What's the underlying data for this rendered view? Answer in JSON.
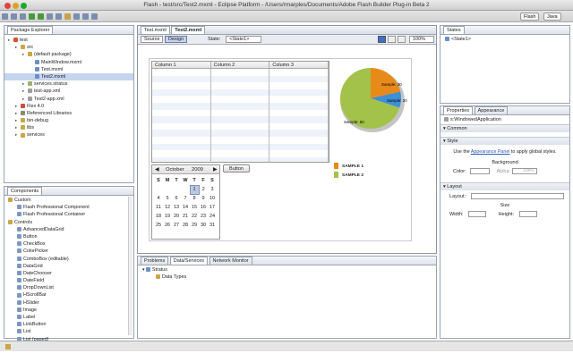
{
  "window": {
    "title": "Flash - test/src/Test2.mxml - Eclipse Platform - /Users/rmarples/Documents/Adobe Flash Builder Plug-in Beta 2"
  },
  "perspectives": [
    "Flash",
    "Java"
  ],
  "package_explorer": {
    "tab": "Package Explorer",
    "items": [
      {
        "label": "test",
        "indent": 0,
        "color": "#d9532c"
      },
      {
        "label": "src",
        "indent": 1,
        "color": "#c9a646"
      },
      {
        "label": "(default package)",
        "indent": 2,
        "color": "#c9a646"
      },
      {
        "label": "MainWindow.mxml",
        "indent": 3,
        "color": "#6b8fc7"
      },
      {
        "label": "Test.mxml",
        "indent": 3,
        "color": "#6b8fc7"
      },
      {
        "label": "Test2.mxml",
        "indent": 3,
        "color": "#6b8fc7",
        "selected": true
      },
      {
        "label": "services.stratus",
        "indent": 2,
        "color": "#9bb06a"
      },
      {
        "label": "test-app.xml",
        "indent": 2,
        "color": "#9e9e9e"
      },
      {
        "label": "Test2-app.xml",
        "indent": 2,
        "color": "#9e9e9e"
      },
      {
        "label": "Flex 4.0",
        "indent": 1,
        "color": "#c74f3e"
      },
      {
        "label": "Referenced Libraries",
        "indent": 1,
        "color": "#8a8a6a"
      },
      {
        "label": "bin-debug",
        "indent": 1,
        "color": "#c9a646"
      },
      {
        "label": "libs",
        "indent": 1,
        "color": "#c9a646"
      },
      {
        "label": "services",
        "indent": 1,
        "color": "#c9a646"
      }
    ]
  },
  "components": {
    "tab": "Components",
    "items": [
      {
        "label": "Custom",
        "folder": true
      },
      {
        "label": "Flash Professional Component"
      },
      {
        "label": "Flash Professional Container"
      },
      {
        "label": "Controls",
        "folder": true
      },
      {
        "label": "AdvancedDataGrid"
      },
      {
        "label": "Button"
      },
      {
        "label": "CheckBox"
      },
      {
        "label": "ColorPicker"
      },
      {
        "label": "ComboBox (editable)"
      },
      {
        "label": "DataGrid"
      },
      {
        "label": "DateChooser"
      },
      {
        "label": "DateField"
      },
      {
        "label": "DropDownList"
      },
      {
        "label": "HScrollBar"
      },
      {
        "label": "HSlider"
      },
      {
        "label": "Image"
      },
      {
        "label": "Label"
      },
      {
        "label": "LinkButton"
      },
      {
        "label": "List"
      },
      {
        "label": "List (paged)"
      }
    ]
  },
  "editor": {
    "tabs": [
      "Test.mxml",
      "Test2.mxml"
    ],
    "source_label": "Source",
    "design_label": "Design",
    "state_label": "State:",
    "state_value": "<State1>",
    "zoom": "100%",
    "datagrid": {
      "columns": [
        "Column 1",
        "Column 2",
        "Column 3"
      ]
    },
    "calendar": {
      "month": "October",
      "year": "2009",
      "days": [
        "S",
        "M",
        "T",
        "W",
        "T",
        "F",
        "S"
      ],
      "weeks": [
        [
          "",
          "",
          "",
          "",
          "1",
          "2",
          "3"
        ],
        [
          "4",
          "5",
          "6",
          "7",
          "8",
          "9",
          "10"
        ],
        [
          "11",
          "12",
          "13",
          "14",
          "15",
          "16",
          "17"
        ],
        [
          "18",
          "19",
          "20",
          "21",
          "22",
          "23",
          "24"
        ],
        [
          "25",
          "26",
          "27",
          "28",
          "29",
          "30",
          "31"
        ]
      ],
      "selected": "1"
    },
    "button_label": "Button",
    "pie": {
      "labels": [
        "Sample: 30",
        "Sample: 50",
        "Sample: 20"
      ]
    },
    "legend": [
      "SAMPLE 1",
      "SAMPLE 2"
    ],
    "colors": {
      "orange": "#e88a1a",
      "green": "#a3c24a",
      "blue": "#3d8fd6"
    }
  },
  "states": {
    "tab": "States",
    "item": "<State1>"
  },
  "properties": {
    "tabs": [
      "Properties",
      "Appearance"
    ],
    "app_name": "s:WindowedApplication",
    "common_label": "Common",
    "style_label": "Style",
    "style_hint_pre": "Use the ",
    "style_hint_link": "Appearance Panel",
    "style_hint_post": " to apply global styles.",
    "background_label": "Background",
    "color_label": "Color:",
    "alpha_label": "Alpha:",
    "alpha_value": "100%",
    "layout_section": "Layout",
    "layout_label": "Layout:",
    "size_label": "Size",
    "width_label": "Width:",
    "height_label": "Height:"
  },
  "bottom": {
    "tabs": [
      "Problems",
      "Data/Services",
      "Network Monitor"
    ],
    "tree": [
      "Stratus",
      "Data Types"
    ]
  }
}
